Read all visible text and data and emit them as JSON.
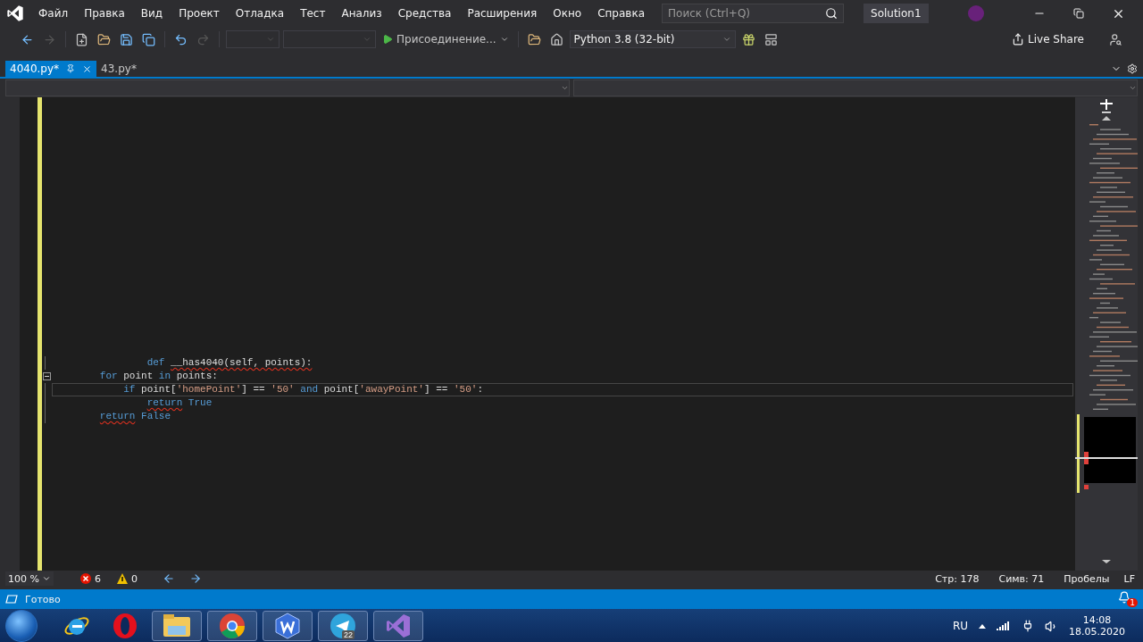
{
  "menu": [
    "Файл",
    "Правка",
    "Вид",
    "Проект",
    "Отладка",
    "Тест",
    "Анализ",
    "Средства",
    "Расширения",
    "Окно",
    "Справка"
  ],
  "search": {
    "placeholder": "Поиск (Ctrl+Q)"
  },
  "solution": "Solution1",
  "toolbar": {
    "run_label": "Присоединение...",
    "environment": "Python 3.8 (32-bit)",
    "live_share": "Live Share"
  },
  "tabs": [
    {
      "label": "4040.py*",
      "selected": true
    },
    {
      "label": "43.py*",
      "selected": false
    }
  ],
  "code": [
    {
      "current": false,
      "fold": false,
      "tokens": [
        {
          "text": "                def ",
          "kind": "keyword",
          "squiggle": false
        },
        {
          "text": "__has4040(self, points):",
          "kind": "text",
          "squiggle": true
        }
      ]
    },
    {
      "current": false,
      "fold": true,
      "tokens": [
        {
          "text": "        for",
          "kind": "keyword",
          "squiggle": false
        },
        {
          "text": " point ",
          "kind": "text",
          "squiggle": false
        },
        {
          "text": "in",
          "kind": "keyword",
          "squiggle": false
        },
        {
          "text": " points:",
          "kind": "text",
          "squiggle": false
        }
      ]
    },
    {
      "current": true,
      "fold": false,
      "tokens": [
        {
          "text": "            if",
          "kind": "keyword",
          "squiggle": false
        },
        {
          "text": " point[",
          "kind": "text",
          "squiggle": false
        },
        {
          "text": "'homePoint'",
          "kind": "string",
          "squiggle": false
        },
        {
          "text": "] == ",
          "kind": "text",
          "squiggle": false
        },
        {
          "text": "'50'",
          "kind": "string",
          "squiggle": false
        },
        {
          "text": " and",
          "kind": "keyword",
          "squiggle": false
        },
        {
          "text": " point[",
          "kind": "text",
          "squiggle": false
        },
        {
          "text": "'awayPoint'",
          "kind": "string",
          "squiggle": false
        },
        {
          "text": "] == ",
          "kind": "text",
          "squiggle": false
        },
        {
          "text": "'50'",
          "kind": "string",
          "squiggle": false
        },
        {
          "text": ":",
          "kind": "text",
          "squiggle": false
        }
      ]
    },
    {
      "current": false,
      "fold": false,
      "tokens": [
        {
          "text": "                return",
          "kind": "keyword",
          "squiggle": true
        },
        {
          "text": " True",
          "kind": "keyword",
          "squiggle": false
        }
      ]
    },
    {
      "current": false,
      "fold": false,
      "tokens": [
        {
          "text": "        return",
          "kind": "keyword",
          "squiggle": true
        },
        {
          "text": " False",
          "kind": "keyword",
          "squiggle": false
        }
      ]
    }
  ],
  "editor_status": {
    "zoom": "100 %",
    "errors": "6",
    "warnings": "0",
    "line": "Стр: 178",
    "column": "Симв: 71",
    "indent": "Пробелы",
    "line_ending": "LF"
  },
  "status": {
    "text": "Готово",
    "notifications": "1"
  },
  "taskbar": {
    "apps": [
      {
        "kind": "ie",
        "pinned": false
      },
      {
        "kind": "opera",
        "pinned": false
      },
      {
        "kind": "explorer",
        "pinned": true
      },
      {
        "kind": "chrome",
        "pinned": true
      },
      {
        "kind": "w",
        "pinned": true
      },
      {
        "kind": "telegram",
        "pinned": true,
        "badge": "22"
      },
      {
        "kind": "vs",
        "pinned": true
      }
    ],
    "language": "RU",
    "time": "14:08",
    "date": "18.05.2020"
  }
}
